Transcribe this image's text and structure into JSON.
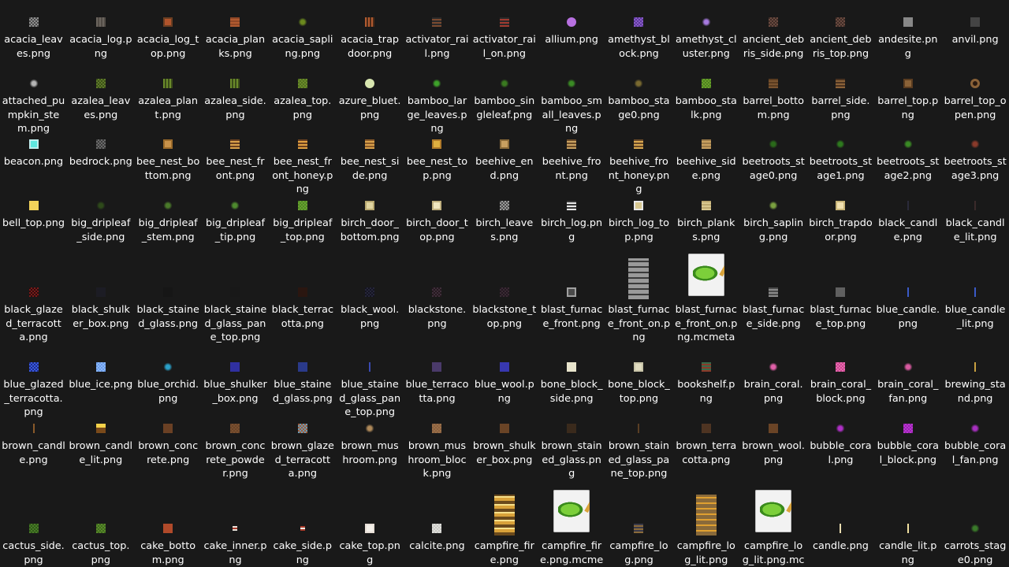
{
  "files": [
    {
      "name": "acacia_leaves.png",
      "icon": "leaves-icon",
      "style": "checker",
      "c1": "#8f8f8f",
      "c2": "#4a4a4a"
    },
    {
      "name": "acacia_log.png",
      "icon": "log-icon",
      "style": "stripes",
      "c1": "#6b655e",
      "c2": "#524c46"
    },
    {
      "name": "acacia_log_top.png",
      "icon": "log-top-icon",
      "style": "frame",
      "c1": "#b0542c",
      "c2": "#6b3e22"
    },
    {
      "name": "acacia_planks.png",
      "icon": "planks-icon",
      "style": "hstripes",
      "c1": "#b05a30",
      "c2": "#8f4726"
    },
    {
      "name": "acacia_sapling.png",
      "icon": "sapling-icon",
      "style": "plant",
      "c1": "#6c8a1e"
    },
    {
      "name": "acacia_trapdoor.png",
      "icon": "trapdoor-icon",
      "style": "stripes",
      "c1": "#b05a30",
      "c2": "#4a2a18"
    },
    {
      "name": "activator_rail.png",
      "icon": "rail-icon",
      "style": "hstripes",
      "c1": "#7a4a30",
      "c2": "#2a2a2a"
    },
    {
      "name": "activator_rail_on.png",
      "icon": "rail-icon",
      "style": "hstripes",
      "c1": "#a13a30",
      "c2": "#2a2a2a"
    },
    {
      "name": "allium.png",
      "icon": "flower-icon",
      "style": "dot",
      "c1": "#b770e0"
    },
    {
      "name": "amethyst_block.png",
      "icon": "amethyst-icon",
      "style": "checker",
      "c1": "#8a5ac8",
      "c2": "#5b3a9a"
    },
    {
      "name": "amethyst_cluster.png",
      "icon": "crystal-icon",
      "style": "plant",
      "c1": "#a77ae0"
    },
    {
      "name": "ancient_debris_side.png",
      "icon": "debris-icon",
      "style": "checker",
      "c1": "#6a4a40",
      "c2": "#3e2c26"
    },
    {
      "name": "ancient_debris_top.png",
      "icon": "debris-icon",
      "style": "checker",
      "c1": "#6a4a40",
      "c2": "#3e2c26"
    },
    {
      "name": "andesite.png",
      "icon": "stone-icon",
      "style": "flat",
      "c1": "#888888"
    },
    {
      "name": "anvil.png",
      "icon": "anvil-icon",
      "style": "flat",
      "c1": "#444444"
    },
    {
      "name": "attached_pumpkin_stem.png",
      "icon": "stem-icon",
      "style": "plant",
      "c1": "#b5b5b5"
    },
    {
      "name": "azalea_leaves.png",
      "icon": "leaves-icon",
      "style": "checker",
      "c1": "#5e7a2a",
      "c2": "#3c5018"
    },
    {
      "name": "azalea_plant.png",
      "icon": "plant-icon",
      "style": "stripes",
      "c1": "#6a8a2a",
      "c2": "#3a4a1a"
    },
    {
      "name": "azalea_side.png",
      "icon": "plant-icon",
      "style": "stripes",
      "c1": "#6a8a2a",
      "c2": "#3a4a1a"
    },
    {
      "name": "azalea_top.png",
      "icon": "block-icon",
      "style": "checker",
      "c1": "#6a8a2a",
      "c2": "#51701f"
    },
    {
      "name": "azure_bluet.png",
      "icon": "flower-icon",
      "style": "dot",
      "c1": "#d8e6b0"
    },
    {
      "name": "bamboo_large_leaves.png",
      "icon": "leaves-icon",
      "style": "plant",
      "c1": "#3ea22a"
    },
    {
      "name": "bamboo_singleleaf.png",
      "icon": "leaf-icon",
      "style": "plant",
      "c1": "#3a7a20"
    },
    {
      "name": "bamboo_small_leaves.png",
      "icon": "leaves-icon",
      "style": "plant",
      "c1": "#3a8a24"
    },
    {
      "name": "bamboo_stage0.png",
      "icon": "sprout-icon",
      "style": "plant",
      "c1": "#7a6a30"
    },
    {
      "name": "bamboo_stalk.png",
      "icon": "stalk-icon",
      "style": "checker",
      "c1": "#6aa02a",
      "c2": "#4c8020"
    },
    {
      "name": "barrel_bottom.png",
      "icon": "barrel-icon",
      "style": "hstripes",
      "c1": "#7a5430",
      "c2": "#5a3c20"
    },
    {
      "name": "barrel_side.png",
      "icon": "barrel-icon",
      "style": "hstripes",
      "c1": "#8a6238",
      "c2": "#4a3220"
    },
    {
      "name": "barrel_top.png",
      "icon": "barrel-icon",
      "style": "frame",
      "c1": "#8a6238",
      "c2": "#5a3c20"
    },
    {
      "name": "barrel_top_open.png",
      "icon": "barrel-icon",
      "style": "ring",
      "c1": "#2a1a10",
      "c2": "#8a6238"
    },
    {
      "name": "beacon.png",
      "icon": "beacon-icon",
      "style": "frame",
      "c1": "#5ee8e0",
      "c2": "#bfeeee"
    },
    {
      "name": "bedrock.png",
      "icon": "bedrock-icon",
      "style": "checker",
      "c1": "#6a6a6a",
      "c2": "#3a3a3a"
    },
    {
      "name": "bee_nest_bottom.png",
      "icon": "nest-icon",
      "style": "frame",
      "c1": "#c8924a",
      "c2": "#9a6a2a"
    },
    {
      "name": "bee_nest_front.png",
      "icon": "nest-icon",
      "style": "hstripes",
      "c1": "#d8a04a",
      "c2": "#6a4020"
    },
    {
      "name": "bee_nest_front_honey.png",
      "icon": "nest-icon",
      "style": "hstripes",
      "c1": "#e0a040",
      "c2": "#6a4020"
    },
    {
      "name": "bee_nest_side.png",
      "icon": "nest-icon",
      "style": "hstripes",
      "c1": "#d8a04a",
      "c2": "#8a5a28"
    },
    {
      "name": "bee_nest_top.png",
      "icon": "nest-icon",
      "style": "frame",
      "c1": "#e0b040",
      "c2": "#b07a2a"
    },
    {
      "name": "beehive_end.png",
      "icon": "hive-icon",
      "style": "frame",
      "c1": "#c8a060",
      "c2": "#8a6a38"
    },
    {
      "name": "beehive_front.png",
      "icon": "hive-icon",
      "style": "hstripes",
      "c1": "#c8a060",
      "c2": "#6a4a28"
    },
    {
      "name": "beehive_front_honey.png",
      "icon": "hive-icon",
      "style": "hstripes",
      "c1": "#d8a850",
      "c2": "#6a4a28"
    },
    {
      "name": "beehive_side.png",
      "icon": "hive-icon",
      "style": "hstripes",
      "c1": "#c8a060",
      "c2": "#9a7a48"
    },
    {
      "name": "beetroots_stage0.png",
      "icon": "crop-icon",
      "style": "plant",
      "c1": "#2a6a1a"
    },
    {
      "name": "beetroots_stage1.png",
      "icon": "crop-icon",
      "style": "plant",
      "c1": "#2e7a1e"
    },
    {
      "name": "beetroots_stage2.png",
      "icon": "crop-icon",
      "style": "plant",
      "c1": "#3a8a24"
    },
    {
      "name": "beetroots_stage3.png",
      "icon": "crop-icon",
      "style": "plant",
      "c1": "#8a3a2a"
    },
    {
      "name": "bell_top.png",
      "icon": "bell-icon",
      "style": "flat",
      "c1": "#f2d35a"
    },
    {
      "name": "big_dripleaf_side.png",
      "icon": "leaf-icon",
      "style": "plant",
      "c1": "#2e4a1a"
    },
    {
      "name": "big_dripleaf_stem.png",
      "icon": "stem-icon",
      "style": "plant",
      "c1": "#4a7a2a"
    },
    {
      "name": "big_dripleaf_tip.png",
      "icon": "leaf-icon",
      "style": "plant",
      "c1": "#4e8a2e"
    },
    {
      "name": "big_dripleaf_top.png",
      "icon": "leaf-icon",
      "style": "checker",
      "c1": "#6aa030",
      "c2": "#4e8a24"
    },
    {
      "name": "birch_door_bottom.png",
      "icon": "door-icon",
      "style": "frame",
      "c1": "#e0d4a0",
      "c2": "#b8a870"
    },
    {
      "name": "birch_door_top.png",
      "icon": "door-icon",
      "style": "frame",
      "c1": "#f0e6c0",
      "c2": "#c0b080"
    },
    {
      "name": "birch_leaves.png",
      "icon": "leaves-icon",
      "style": "checker",
      "c1": "#9a9a9a",
      "c2": "#4a4a4a"
    },
    {
      "name": "birch_log.png",
      "icon": "log-icon",
      "style": "hstripes",
      "c1": "#e8e8e8",
      "c2": "#3a3a3a"
    },
    {
      "name": "birch_log_top.png",
      "icon": "log-top-icon",
      "style": "frame",
      "c1": "#d8c890",
      "c2": "#e8e8e8"
    },
    {
      "name": "birch_planks.png",
      "icon": "planks-icon",
      "style": "hstripes",
      "c1": "#d8c890",
      "c2": "#bca870"
    },
    {
      "name": "birch_sapling.png",
      "icon": "sapling-icon",
      "style": "plant",
      "c1": "#7aa040"
    },
    {
      "name": "birch_trapdoor.png",
      "icon": "trapdoor-icon",
      "style": "frame",
      "c1": "#f0e0b0",
      "c2": "#c8b478"
    },
    {
      "name": "black_candle.png",
      "icon": "candle-icon",
      "style": "candle",
      "c1": "#2a2a3a"
    },
    {
      "name": "black_candle_lit.png",
      "icon": "candle-lit-icon",
      "style": "candle",
      "c1": "#3a2a2a"
    },
    {
      "name": "black_glazed_terracotta.png",
      "icon": "terracotta-icon",
      "style": "checker",
      "c1": "#7a1a1a",
      "c2": "#2a0e0e"
    },
    {
      "name": "black_shulker_box.png",
      "icon": "shulker-icon",
      "style": "flat",
      "c1": "#1c1c24"
    },
    {
      "name": "black_stained_glass.png",
      "icon": "glass-icon",
      "style": "flat",
      "c1": "#161616"
    },
    {
      "name": "black_stained_glass_pane_top.png",
      "icon": "glass-pane-icon",
      "style": "flat",
      "c1": "#181818"
    },
    {
      "name": "black_terracotta.png",
      "icon": "terracotta-icon",
      "style": "flat",
      "c1": "#2a1610"
    },
    {
      "name": "black_wool.png",
      "icon": "wool-icon",
      "style": "checker",
      "c1": "#26263a",
      "c2": "#141420"
    },
    {
      "name": "blackstone.png",
      "icon": "blackstone-icon",
      "style": "checker",
      "c1": "#3e2e3a",
      "c2": "#24181e"
    },
    {
      "name": "blackstone_top.png",
      "icon": "blackstone-icon",
      "style": "checker",
      "c1": "#3a2a34",
      "c2": "#221820"
    },
    {
      "name": "blast_furnace_front.png",
      "icon": "furnace-icon",
      "style": "frame",
      "c1": "#4a4a4a",
      "c2": "#a0a0a0"
    },
    {
      "name": "blast_furnace_front_on.png",
      "icon": "furnace-icon",
      "style": "logs",
      "c1": "#9a9a9a",
      "c2": "#3a3a3a",
      "size": "l"
    },
    {
      "name": "blast_furnace_front_on.png.mcmeta",
      "icon": "file-icon",
      "style": "doc",
      "size": "d"
    },
    {
      "name": "blast_furnace_side.png",
      "icon": "furnace-icon",
      "style": "hstripes",
      "c1": "#8a8a8a",
      "c2": "#4a4a4a"
    },
    {
      "name": "blast_furnace_top.png",
      "icon": "furnace-icon",
      "style": "flat",
      "c1": "#606060"
    },
    {
      "name": "blue_candle.png",
      "icon": "candle-icon",
      "style": "candle",
      "c1": "#3a5ac8"
    },
    {
      "name": "blue_candle_lit.png",
      "icon": "candle-lit-icon",
      "style": "candle",
      "c1": "#3a5ac8"
    },
    {
      "name": "blue_glazed_terracotta.png",
      "icon": "terracotta-icon",
      "style": "checker",
      "c1": "#3a5ae0",
      "c2": "#1e2e8a"
    },
    {
      "name": "blue_ice.png",
      "icon": "ice-icon",
      "style": "checker",
      "c1": "#8ab8f8",
      "c2": "#6a9ae8"
    },
    {
      "name": "blue_orchid.png",
      "icon": "flower-icon",
      "style": "plant",
      "c1": "#2aa0c8"
    },
    {
      "name": "blue_shulker_box.png",
      "icon": "shulker-icon",
      "style": "flat",
      "c1": "#3030a0"
    },
    {
      "name": "blue_stained_glass.png",
      "icon": "glass-icon",
      "style": "flat",
      "c1": "#2a3a8a"
    },
    {
      "name": "blue_stained_glass_pane_top.png",
      "icon": "glass-pane-icon",
      "style": "candle",
      "c1": "#3a4ab0"
    },
    {
      "name": "blue_terracotta.png",
      "icon": "terracotta-icon",
      "style": "flat",
      "c1": "#4a3a6a"
    },
    {
      "name": "blue_wool.png",
      "icon": "wool-icon",
      "style": "flat",
      "c1": "#3838b0"
    },
    {
      "name": "bone_block_side.png",
      "icon": "bone-icon",
      "style": "flat",
      "c1": "#e8e4cc"
    },
    {
      "name": "bone_block_top.png",
      "icon": "bone-icon",
      "style": "frame",
      "c1": "#e0dcc0",
      "c2": "#c8c4a8"
    },
    {
      "name": "bookshelf.png",
      "icon": "bookshelf-icon",
      "style": "hstripes",
      "c1": "#8a3a2a",
      "c2": "#3a6a4a"
    },
    {
      "name": "brain_coral.png",
      "icon": "coral-icon",
      "style": "plant",
      "c1": "#e060a8"
    },
    {
      "name": "brain_coral_block.png",
      "icon": "coral-block-icon",
      "style": "checker",
      "c1": "#e86ab0",
      "c2": "#c8488e"
    },
    {
      "name": "brain_coral_fan.png",
      "icon": "coral-fan-icon",
      "style": "plant",
      "c1": "#d85aa0"
    },
    {
      "name": "brewing_stand.png",
      "icon": "brewing-icon",
      "style": "candle",
      "c1": "#c8a040"
    },
    {
      "name": "brown_candle.png",
      "icon": "candle-icon",
      "style": "candle",
      "c1": "#8a5a2a"
    },
    {
      "name": "brown_candle_lit.png",
      "icon": "candle-lit-icon",
      "style": "flame"
    },
    {
      "name": "brown_concrete.png",
      "icon": "concrete-icon",
      "style": "flat",
      "c1": "#6a4024"
    },
    {
      "name": "brown_concrete_powder.png",
      "icon": "powder-icon",
      "style": "checker",
      "c1": "#7a5030",
      "c2": "#6a4428"
    },
    {
      "name": "brown_glazed_terracotta.png",
      "icon": "terracotta-icon",
      "style": "checker",
      "c1": "#6a9ab0",
      "c2": "#a05a3a"
    },
    {
      "name": "brown_mushroom.png",
      "icon": "mushroom-icon",
      "style": "plant",
      "c1": "#b08a5a"
    },
    {
      "name": "brown_mushroom_block.png",
      "icon": "mushroom-block-icon",
      "style": "checker",
      "c1": "#9a7048",
      "c2": "#8a6040"
    },
    {
      "name": "brown_shulker_box.png",
      "icon": "shulker-icon",
      "style": "flat",
      "c1": "#6a4426"
    },
    {
      "name": "brown_stained_glass.png",
      "icon": "glass-icon",
      "style": "flat",
      "c1": "#3a2a1c"
    },
    {
      "name": "brown_stained_glass_pane_top.png",
      "icon": "glass-pane-icon",
      "style": "candle",
      "c1": "#5a3e24"
    },
    {
      "name": "brown_terracotta.png",
      "icon": "terracotta-icon",
      "style": "flat",
      "c1": "#4e3422"
    },
    {
      "name": "brown_wool.png",
      "icon": "wool-icon",
      "style": "flat",
      "c1": "#6a4426"
    },
    {
      "name": "bubble_coral.png",
      "icon": "coral-icon",
      "style": "plant",
      "c1": "#b030c8"
    },
    {
      "name": "bubble_coral_block.png",
      "icon": "coral-block-icon",
      "style": "checker",
      "c1": "#b838d0",
      "c2": "#9a20b0"
    },
    {
      "name": "bubble_coral_fan.png",
      "icon": "coral-fan-icon",
      "style": "plant",
      "c1": "#a830c0"
    },
    {
      "name": "cactus_side.png",
      "icon": "cactus-icon",
      "style": "checker",
      "c1": "#4a7a28",
      "c2": "#2e5a18"
    },
    {
      "name": "cactus_top.png",
      "icon": "cactus-icon",
      "style": "checker",
      "c1": "#5a8a2a",
      "c2": "#3e6a1e"
    },
    {
      "name": "cake_bottom.png",
      "icon": "cake-icon",
      "style": "flat",
      "c1": "#b04a2a"
    },
    {
      "name": "cake_inner.png",
      "icon": "cake-icon",
      "style": "hstripes",
      "c1": "#e8e0d8",
      "c2": "#a83a2a",
      "size": "s"
    },
    {
      "name": "cake_side.png",
      "icon": "cake-icon",
      "style": "hstripes",
      "c1": "#a83a2a",
      "c2": "#f0ece6",
      "size": "s"
    },
    {
      "name": "cake_top.png",
      "icon": "cake-icon",
      "style": "frame",
      "c1": "#f4f0ea",
      "c2": "#e8e0d8"
    },
    {
      "name": "calcite.png",
      "icon": "calcite-icon",
      "style": "checker",
      "c1": "#e0e0dc",
      "c2": "#c8c8c4"
    },
    {
      "name": "campfire_fire.png",
      "icon": "fire-icon",
      "style": "fire",
      "size": "l"
    },
    {
      "name": "campfire_fire.png.mcmeta",
      "icon": "file-icon",
      "style": "doc",
      "size": "d"
    },
    {
      "name": "campfire_log.png",
      "icon": "log-icon",
      "style": "hstripes",
      "c1": "#8a6a3a",
      "c2": "#3a3a4a"
    },
    {
      "name": "campfire_log_lit.png",
      "icon": "log-icon",
      "style": "logs",
      "c1": "#8a6a3a",
      "c2": "#e0a030",
      "size": "l"
    },
    {
      "name": "campfire_log_lit.png.mcmeta",
      "icon": "file-icon",
      "style": "doc",
      "size": "d"
    },
    {
      "name": "candle.png",
      "icon": "candle-icon",
      "style": "candle",
      "c1": "#e8dcb0"
    },
    {
      "name": "candle_lit.png",
      "icon": "candle-lit-icon",
      "style": "candle",
      "c1": "#f0e0a0"
    },
    {
      "name": "carrots_stage0.png",
      "icon": "crop-icon",
      "style": "plant",
      "c1": "#3a7a2a"
    }
  ]
}
